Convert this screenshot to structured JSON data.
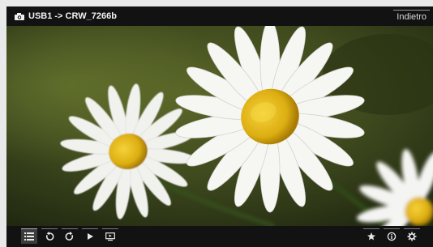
{
  "header": {
    "title": "USB1 -> CRW_7266b",
    "back_label": "Indietro",
    "title_icon": "camera-icon"
  },
  "photo": {
    "subject": "daisy-flowers-photo"
  },
  "toolbar": {
    "left_buttons": [
      {
        "name": "list-icon",
        "active": true
      },
      {
        "name": "rotate-left-icon",
        "active": false
      },
      {
        "name": "rotate-right-icon",
        "active": false
      },
      {
        "name": "play-icon",
        "active": false
      },
      {
        "name": "slideshow-icon",
        "active": false
      }
    ],
    "right_buttons": [
      {
        "name": "star-icon"
      },
      {
        "name": "info-icon"
      },
      {
        "name": "settings-icon"
      }
    ]
  },
  "colors": {
    "bar_background": "#121212",
    "petal": "#f4f4f2",
    "flower_center": "#e2b514",
    "background_green": "#3f4a22"
  }
}
